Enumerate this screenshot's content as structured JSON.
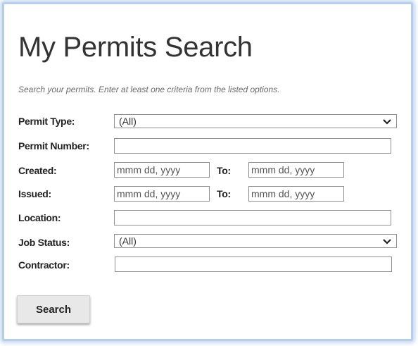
{
  "header": {
    "title": "My Permits Search",
    "intro": "Search your permits. Enter at least one criteria from the listed options."
  },
  "form": {
    "permit_type": {
      "label": "Permit Type:",
      "value": "(All)"
    },
    "permit_number": {
      "label": "Permit Number:",
      "value": ""
    },
    "created": {
      "label": "Created:",
      "from_placeholder": "mmm dd, yyyy",
      "to_label": "To:",
      "to_placeholder": "mmm dd, yyyy"
    },
    "issued": {
      "label": "Issued:",
      "from_placeholder": "mmm dd, yyyy",
      "to_label": "To:",
      "to_placeholder": "mmm dd, yyyy"
    },
    "location": {
      "label": "Location:",
      "value": ""
    },
    "job_status": {
      "label": "Job Status:",
      "value": "(All)"
    },
    "contractor": {
      "label": "Contractor:",
      "value": ""
    }
  },
  "actions": {
    "search_label": "Search"
  },
  "icons": {
    "dropdown": "chevron-down-icon"
  },
  "colors": {
    "frame_border": "#b7cdea",
    "title": "#333333",
    "button_bg": "#e8e8e8"
  }
}
